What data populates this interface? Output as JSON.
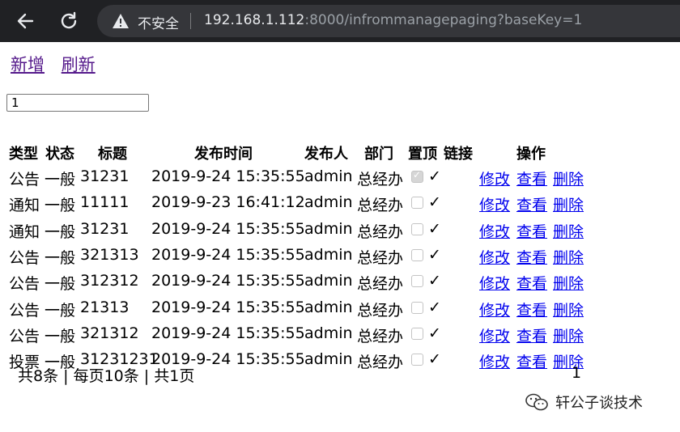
{
  "browser": {
    "security_label": "不安全",
    "url_host": "192.168.1.112",
    "url_rest": ":8000/infrommanagepaging?baseKey=1"
  },
  "toolbar": {
    "add_label": "新增",
    "refresh_label": "刷新"
  },
  "search": {
    "value": "1"
  },
  "table": {
    "headers": {
      "type": "类型",
      "status": "状态",
      "title": "标题",
      "time": "发布时间",
      "publisher": "发布人",
      "dept": "部门",
      "pinned": "置顶",
      "link": "链接",
      "actions": "操作"
    },
    "action_labels": {
      "edit": "修改",
      "view": "查看",
      "delete": "删除"
    },
    "rows": [
      {
        "type": "公告",
        "status": "一般",
        "title": "31231",
        "time": "2019-9-24 15:35:55",
        "publisher": "admin",
        "dept": "总经办",
        "pinned": true,
        "link": "✓"
      },
      {
        "type": "通知",
        "status": "一般",
        "title": "11111",
        "time": "2019-9-23 16:41:12",
        "publisher": "admin",
        "dept": "总经办",
        "pinned": false,
        "link": "✓"
      },
      {
        "type": "通知",
        "status": "一般",
        "title": "31231",
        "time": "2019-9-24 15:35:55",
        "publisher": "admin",
        "dept": "总经办",
        "pinned": false,
        "link": "✓"
      },
      {
        "type": "公告",
        "status": "一般",
        "title": "321313",
        "time": "2019-9-24 15:35:55",
        "publisher": "admin",
        "dept": "总经办",
        "pinned": false,
        "link": "✓"
      },
      {
        "type": "公告",
        "status": "一般",
        "title": "312312",
        "time": "2019-9-24 15:35:55",
        "publisher": "admin",
        "dept": "总经办",
        "pinned": false,
        "link": "✓"
      },
      {
        "type": "公告",
        "status": "一般",
        "title": "21313",
        "time": "2019-9-24 15:35:55",
        "publisher": "admin",
        "dept": "总经办",
        "pinned": false,
        "link": "✓"
      },
      {
        "type": "公告",
        "status": "一般",
        "title": "321312",
        "time": "2019-9-24 15:35:55",
        "publisher": "admin",
        "dept": "总经办",
        "pinned": false,
        "link": "✓"
      },
      {
        "type": "投票",
        "status": "一般",
        "title": "31231231",
        "time": "2019-9-24 15:35:55",
        "publisher": "admin",
        "dept": "总经办",
        "pinned": false,
        "link": "✓"
      }
    ]
  },
  "pagination": {
    "summary": "共8条 | 每页10条 | 共1页",
    "page": "1"
  },
  "watermark": {
    "text": "轩公子谈技术"
  }
}
